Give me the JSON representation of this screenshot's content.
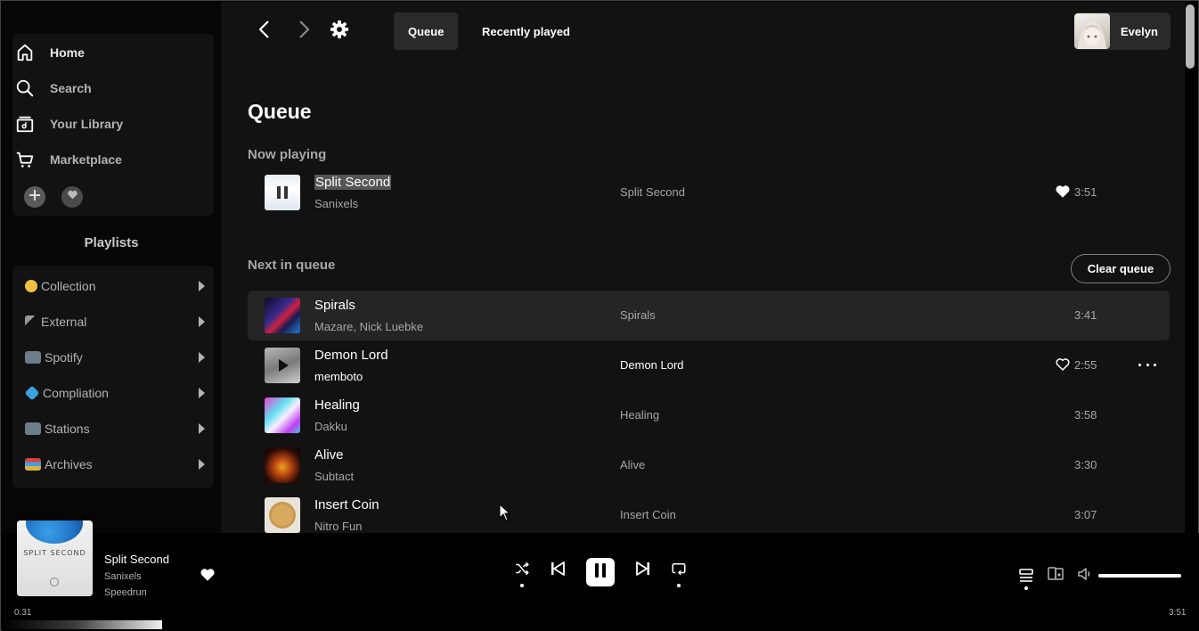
{
  "sidebar": {
    "nav": [
      {
        "label": "Home",
        "icon": "home-icon"
      },
      {
        "label": "Search",
        "icon": "search-icon"
      },
      {
        "label": "Your Library",
        "icon": "library-icon"
      },
      {
        "label": "Marketplace",
        "icon": "cart-icon"
      }
    ],
    "playlists_title": "Playlists",
    "playlists": [
      {
        "label": "Collection",
        "emoji_color": "#f0c040"
      },
      {
        "label": "External",
        "emoji_color": "#8a8a8a"
      },
      {
        "label": "Spotify",
        "emoji_color": "#6e7d8a"
      },
      {
        "label": "Compliation",
        "emoji_color": "#3ca0e0"
      },
      {
        "label": "Stations",
        "emoji_color": "#6e7d8a"
      },
      {
        "label": "Archives",
        "emoji_color": "#d0a040"
      }
    ]
  },
  "topbar": {
    "tabs": [
      {
        "label": "Queue",
        "active": true
      },
      {
        "label": "Recently played",
        "active": false
      }
    ],
    "user_name": "Evelyn"
  },
  "queue": {
    "title": "Queue",
    "now_playing_label": "Now playing",
    "next_label": "Next in queue",
    "clear_label": "Clear queue",
    "now_playing": {
      "title": "Split Second",
      "artist": "Sanixels",
      "album": "Split Second",
      "duration": "3:51",
      "liked": true
    },
    "next": [
      {
        "title": "Spirals",
        "artist": "Mazare, Nick Luebke",
        "album": "Spirals",
        "duration": "3:41"
      },
      {
        "title": "Demon Lord",
        "artist": "memboto",
        "album": "Demon Lord",
        "duration": "2:55"
      },
      {
        "title": "Healing",
        "artist": "Dakku",
        "album": "Healing",
        "duration": "3:58"
      },
      {
        "title": "Alive",
        "artist": "Subtact",
        "album": "Alive",
        "duration": "3:30"
      },
      {
        "title": "Insert Coin",
        "artist": "Nitro Fun",
        "album": "Insert Coin",
        "duration": "3:07"
      }
    ]
  },
  "player": {
    "title": "Split Second",
    "artist": "Sanixels",
    "album": "Speedrun",
    "art_text": "SPLIT SECOND",
    "elapsed": "0:31",
    "total": "3:51",
    "progress": 0.134,
    "volume": 1.0
  },
  "colors": {
    "background": "#121212",
    "sidebar": "#060606",
    "text_secondary": "#a7a7a7"
  }
}
